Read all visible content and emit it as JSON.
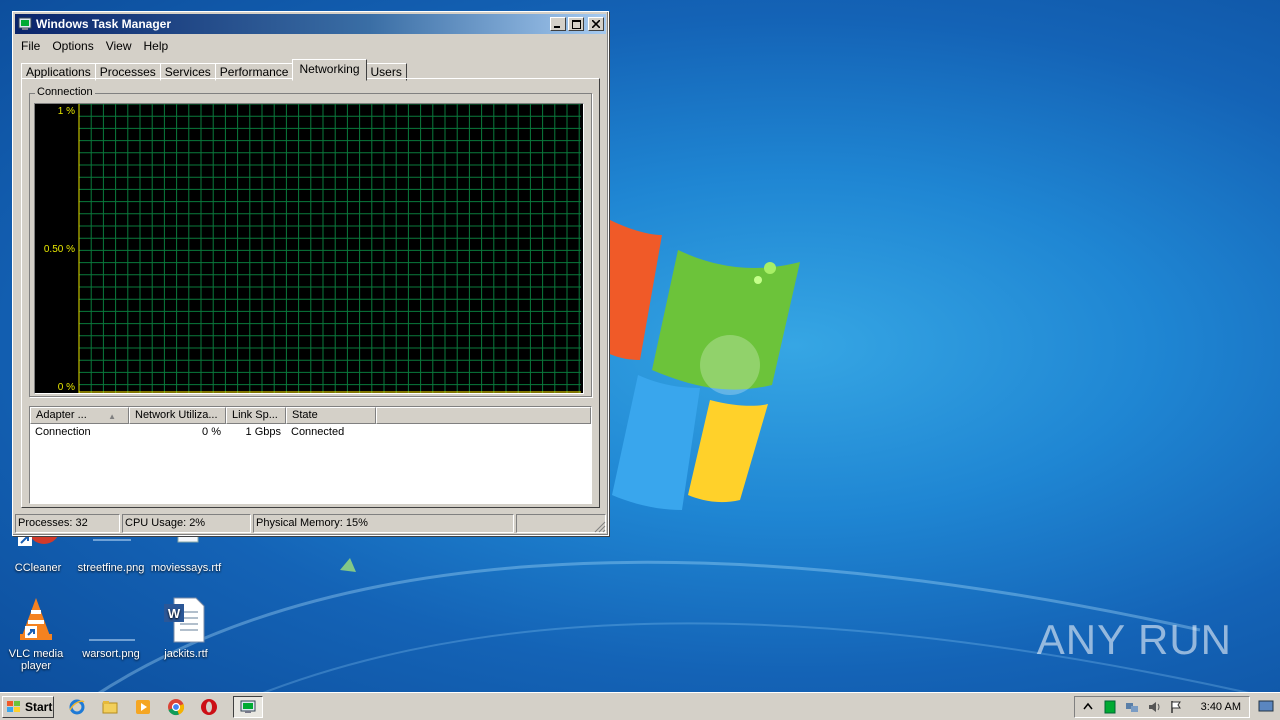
{
  "window": {
    "title": "Windows Task Manager",
    "menu": [
      "File",
      "Options",
      "View",
      "Help"
    ],
    "tabs": [
      "Applications",
      "Processes",
      "Services",
      "Performance",
      "Networking",
      "Users"
    ],
    "active_tab": "Networking"
  },
  "graph": {
    "group_label": "Connection",
    "y_labels": {
      "top": "1 %",
      "mid": "0.50 %",
      "bottom": "0 %"
    },
    "utilization_fraction": 0
  },
  "adapters": {
    "columns": [
      "Adapter ...",
      "Network Utiliza...",
      "Link Sp...",
      "State"
    ],
    "rows": [
      {
        "name": "Connection",
        "utilization": "0 %",
        "link_speed": "1 Gbps",
        "state": "Connected"
      }
    ]
  },
  "status": {
    "processes": "Processes: 32",
    "cpu": "CPU Usage: 2%",
    "memory": "Physical Memory: 15%"
  },
  "desktop_icons": [
    {
      "label": "CCleaner"
    },
    {
      "label": "streetfine.png"
    },
    {
      "label": "moviessays.rtf"
    },
    {
      "label": "VLC media player"
    },
    {
      "label": "warsort.png"
    },
    {
      "label": "jackits.rtf"
    }
  ],
  "taskbar": {
    "start_label": "Start",
    "clock": "3:40 AM"
  },
  "watermark": "ANY RUN"
}
